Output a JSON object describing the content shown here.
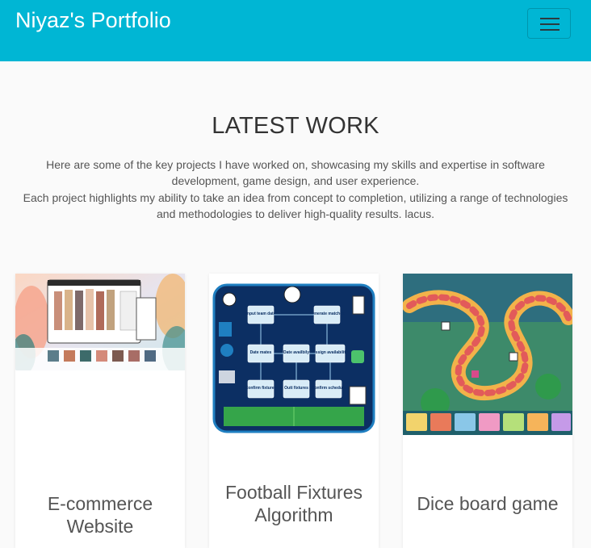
{
  "navbar": {
    "brand": "Niyaz's Portfolio",
    "toggle_icon": "hamburger-menu-icon",
    "background_color": "#00b6d4"
  },
  "latest_work": {
    "heading": "LATEST WORK",
    "intro_line1": "Here are some of the key projects I have worked on, showcasing my skills and expertise in software development, game design, and user experience.",
    "intro_line2": "Each project highlights my ability to take an idea from concept to completion, utilizing a range of technologies and methodologies to deliver high-quality results. lacus."
  },
  "projects": [
    {
      "title": "E-commerce Website",
      "image": "ecommerce-website-image"
    },
    {
      "title": "Football Fixtures Algorithm",
      "image": "football-fixtures-flowchart-image"
    },
    {
      "title": "Dice board game",
      "image": "dice-board-game-image"
    }
  ],
  "flowchart_labels": {
    "input_team_data": "Input team data",
    "generate_matches": "Generate matches",
    "date_mates": "Date mates",
    "date_availbily": "Date availbily",
    "assign_availability": "Assign availability",
    "confirm_fixtures": "Confirm fixtures",
    "outt_fixtures": "Outt fixtures",
    "confirm_schedule": "Confirm schedule"
  }
}
